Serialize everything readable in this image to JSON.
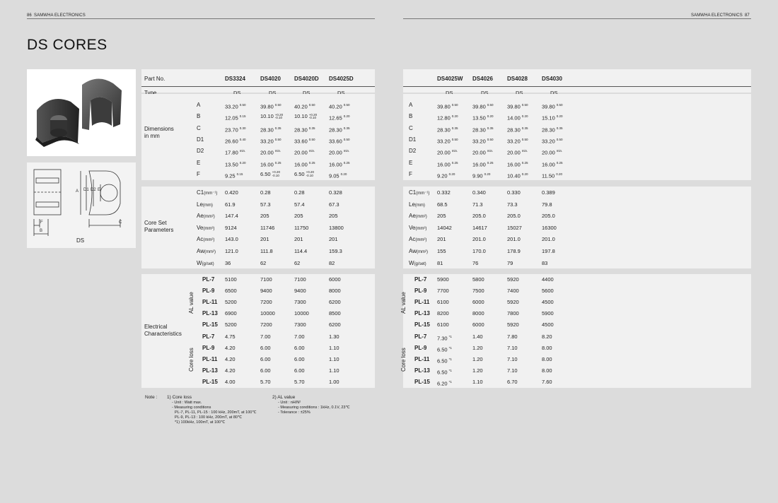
{
  "header": {
    "left_page": "86",
    "right_page": "87",
    "company": "SAMWHA ELECTRONICS"
  },
  "title": "DS CORES",
  "drawing": {
    "caption": "DS",
    "dims": [
      "A",
      "D1",
      "D2",
      "E",
      "F",
      "B",
      "C"
    ]
  },
  "labels": {
    "part_no": "Part No.",
    "type": "Type",
    "dimensions": "Dimensions",
    "in_mm": "in mm",
    "core_set": "Core Set",
    "parameters": "Parameters",
    "electrical": "Electrical",
    "characteristics": "Characteristics",
    "min_suffix": "min.",
    "al_value": "AL value",
    "core_loss": "Core loss"
  },
  "left": {
    "parts": [
      "DS3324",
      "DS4020",
      "DS4020D",
      "DS4025D"
    ],
    "type": [
      "DS",
      "DS",
      "DS",
      "DS"
    ],
    "dims": [
      {
        "k": "A",
        "v": [
          [
            "33.20",
            "0.50"
          ],
          [
            "39.80",
            "0.50"
          ],
          [
            "40.20",
            "0.50"
          ],
          [
            "40.20",
            "0.50"
          ]
        ]
      },
      {
        "k": "B",
        "v": [
          [
            "12.05",
            "0.15"
          ],
          [
            "10.10",
            "+0.20|-0.10"
          ],
          [
            "10.10",
            "+0.20|-0.10"
          ],
          [
            "12.65",
            "0.20"
          ]
        ]
      },
      {
        "k": "C",
        "v": [
          [
            "23.70",
            "0.30"
          ],
          [
            "28.30",
            "0.35"
          ],
          [
            "28.30",
            "0.35"
          ],
          [
            "28.30",
            "0.35"
          ]
        ]
      },
      {
        "k": "D1",
        "v": [
          [
            "26.60",
            "0.40"
          ],
          [
            "33.20",
            "0.50"
          ],
          [
            "33.60",
            "0.50"
          ],
          [
            "33.60",
            "0.50"
          ]
        ]
      },
      {
        "k": "D2",
        "v": [
          [
            "17.80",
            "min."
          ],
          [
            "20.00",
            "min."
          ],
          [
            "20.00",
            "min."
          ],
          [
            "20.00",
            "min."
          ]
        ]
      },
      {
        "k": "E",
        "v": [
          [
            "13.50",
            "0.20"
          ],
          [
            "16.00",
            "0.25"
          ],
          [
            "16.00",
            "0.25"
          ],
          [
            "16.00",
            "0.25"
          ]
        ]
      },
      {
        "k": "F",
        "v": [
          [
            "9.25",
            "0.15"
          ],
          [
            "6.50",
            "+0.20|-0.10"
          ],
          [
            "6.50",
            "+0.20|-0.10"
          ],
          [
            "9.05",
            "0.20"
          ]
        ]
      }
    ],
    "params": [
      {
        "k": "C1",
        "u": "(mm⁻¹)",
        "v": [
          "0.420",
          "0.28",
          "0.28",
          "0.328"
        ]
      },
      {
        "k": "Le",
        "u": "(mm)",
        "v": [
          "61.9",
          "57.3",
          "57.4",
          "67.3"
        ]
      },
      {
        "k": "Ae",
        "u": "(mm²)",
        "v": [
          "147.4",
          "205",
          "205",
          "205"
        ]
      },
      {
        "k": "Ve",
        "u": "(mm³)",
        "v": [
          "9124",
          "11746",
          "11750",
          "13800"
        ]
      },
      {
        "k": "Ac",
        "u": "(mm²)",
        "v": [
          "143.0",
          "201",
          "201",
          "201"
        ]
      },
      {
        "k": "Aw",
        "u": "(mm²)",
        "v": [
          "121.0",
          "111.8",
          "114.4",
          "159.3"
        ]
      },
      {
        "k": "W",
        "u": "(g/set)",
        "v": [
          "36",
          "62",
          "62",
          "82"
        ]
      }
    ],
    "al": [
      {
        "k": "PL-7",
        "v": [
          "5100",
          "7100",
          "7100",
          "6000"
        ]
      },
      {
        "k": "PL-9",
        "v": [
          "6500",
          "9400",
          "9400",
          "8000"
        ]
      },
      {
        "k": "PL-11",
        "v": [
          "5200",
          "7200",
          "7300",
          "6200"
        ]
      },
      {
        "k": "PL-13",
        "v": [
          "6900",
          "10000",
          "10000",
          "8500"
        ]
      },
      {
        "k": "PL-15",
        "v": [
          "5200",
          "7200",
          "7300",
          "6200"
        ]
      }
    ],
    "loss": [
      {
        "k": "PL-7",
        "v": [
          "4.75",
          "7.00",
          "7.00",
          "1.30"
        ]
      },
      {
        "k": "PL-9",
        "v": [
          "4.20",
          "6.00",
          "6.00",
          "1.10"
        ]
      },
      {
        "k": "PL-11",
        "v": [
          "4.20",
          "6.00",
          "6.00",
          "1.10"
        ]
      },
      {
        "k": "PL-13",
        "v": [
          "4.20",
          "6.00",
          "6.00",
          "1.10"
        ]
      },
      {
        "k": "PL-15",
        "v": [
          "4.00",
          "5.70",
          "5.70",
          "1.00"
        ]
      }
    ]
  },
  "right": {
    "parts": [
      "DS4025W",
      "DS4026",
      "DS4028",
      "DS4030"
    ],
    "type": [
      "DS",
      "DS",
      "DS",
      "DS"
    ],
    "dims": [
      {
        "k": "A",
        "v": [
          [
            "39.80",
            "0.50"
          ],
          [
            "39.80",
            "0.50"
          ],
          [
            "39.80",
            "0.50"
          ],
          [
            "39.80",
            "0.50"
          ]
        ]
      },
      {
        "k": "B",
        "v": [
          [
            "12.80",
            "0.20"
          ],
          [
            "13.50",
            "0.20"
          ],
          [
            "14.00",
            "0.20"
          ],
          [
            "15.10",
            "0.20"
          ]
        ]
      },
      {
        "k": "C",
        "v": [
          [
            "28.30",
            "0.35"
          ],
          [
            "28.30",
            "0.35"
          ],
          [
            "28.30",
            "0.35"
          ],
          [
            "28.30",
            "0.35"
          ]
        ]
      },
      {
        "k": "D1",
        "v": [
          [
            "33.20",
            "0.50"
          ],
          [
            "33.20",
            "0.50"
          ],
          [
            "33.20",
            "0.50"
          ],
          [
            "33.20",
            "0.50"
          ]
        ]
      },
      {
        "k": "D2",
        "v": [
          [
            "20.00",
            "min."
          ],
          [
            "20.00",
            "min."
          ],
          [
            "20.00",
            "min."
          ],
          [
            "20.00",
            "min."
          ]
        ]
      },
      {
        "k": "E",
        "v": [
          [
            "16.00",
            "0.25"
          ],
          [
            "16.00",
            "0.25"
          ],
          [
            "16.00",
            "0.25"
          ],
          [
            "16.00",
            "0.25"
          ]
        ]
      },
      {
        "k": "F",
        "v": [
          [
            "9.20",
            "0.20"
          ],
          [
            "9.90",
            "0.20"
          ],
          [
            "10.40",
            "0.20"
          ],
          [
            "11.50",
            "0.20"
          ]
        ]
      }
    ],
    "params": [
      {
        "k": "C1",
        "u": "(mm⁻¹)",
        "v": [
          "0.332",
          "0.340",
          "0.330",
          "0.389"
        ]
      },
      {
        "k": "Le",
        "u": "(mm)",
        "v": [
          "68.5",
          "71.3",
          "73.3",
          "79.8"
        ]
      },
      {
        "k": "Ae",
        "u": "(mm²)",
        "v": [
          "205",
          "205.0",
          "205.0",
          "205.0"
        ]
      },
      {
        "k": "Ve",
        "u": "(mm³)",
        "v": [
          "14042",
          "14617",
          "15027",
          "16300"
        ]
      },
      {
        "k": "Ac",
        "u": "(mm²)",
        "v": [
          "201",
          "201.0",
          "201.0",
          "201.0"
        ]
      },
      {
        "k": "Aw",
        "u": "(mm²)",
        "v": [
          "155",
          "170.0",
          "178.9",
          "197.8"
        ]
      },
      {
        "k": "W",
        "u": "(g/set)",
        "v": [
          "81",
          "76",
          "79",
          "83"
        ]
      }
    ],
    "al": [
      {
        "k": "PL-7",
        "v": [
          "5900",
          "5800",
          "5920",
          "4400"
        ]
      },
      {
        "k": "PL-9",
        "v": [
          "7700",
          "7500",
          "7400",
          "5600"
        ]
      },
      {
        "k": "PL-11",
        "v": [
          "6100",
          "6000",
          "5920",
          "4500"
        ]
      },
      {
        "k": "PL-13",
        "v": [
          "8200",
          "8000",
          "7800",
          "5900"
        ]
      },
      {
        "k": "PL-15",
        "v": [
          "6100",
          "6000",
          "5920",
          "4500"
        ]
      }
    ],
    "loss": [
      {
        "k": "PL-7",
        "v": [
          "7.30*1",
          "1.40",
          "7.80",
          "8.20"
        ]
      },
      {
        "k": "PL-9",
        "v": [
          "6.50*1",
          "1.20",
          "7.10",
          "8.00"
        ]
      },
      {
        "k": "PL-11",
        "v": [
          "6.50*1",
          "1.20",
          "7.10",
          "8.00"
        ]
      },
      {
        "k": "PL-13",
        "v": [
          "6.50*1",
          "1.20",
          "7.10",
          "8.00"
        ]
      },
      {
        "k": "PL-15",
        "v": [
          "6.20*1",
          "1.10",
          "6.70",
          "7.60"
        ]
      }
    ]
  },
  "notes": {
    "label": "Note :",
    "core_loss_title": "1) Core loss",
    "core_loss_lines": [
      "- Unit : Watt max.",
      "- Measuring conditions",
      "PL-7, PL-11, PL-15    : 100 kHz, 200mT, at 100℃",
      "PL-9, PL-13              : 100 kHz, 200mT, at 80℃",
      "*1) 100kHz, 100mT, at 100℃"
    ],
    "al_title": "2) AL value",
    "al_lines": [
      "- Unit : nH/N²",
      "- Measuring conditions : 1kHz, 0.1V, 23℃",
      "- Tolerance : ±25%"
    ]
  },
  "colors": {
    "panel": "#f1f1f1",
    "page": "#dcdcdc",
    "core": "#4a4a4a"
  }
}
